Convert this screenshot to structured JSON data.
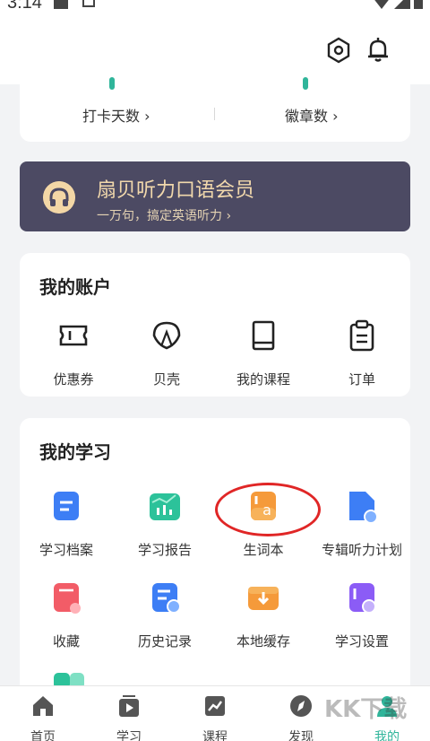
{
  "status_bar": {
    "time": "3:14"
  },
  "top_bar": {
    "icons": [
      "settings-hexagon-icon",
      "bell-icon"
    ]
  },
  "stats": {
    "checkin_label": "打卡天数",
    "badges_label": "徽章数",
    "chevron": "›"
  },
  "vip": {
    "title": "扇贝听力口语会员",
    "subtitle": "一万句，搞定英语听力 ›"
  },
  "account": {
    "title": "我的账户",
    "items": [
      {
        "label": "优惠券",
        "icon": "coupon-icon"
      },
      {
        "label": "贝壳",
        "icon": "shell-icon"
      },
      {
        "label": "我的课程",
        "icon": "book-icon"
      },
      {
        "label": "订单",
        "icon": "clipboard-icon"
      }
    ]
  },
  "study": {
    "title": "我的学习",
    "items": [
      {
        "label": "学习档案",
        "icon": "file-icon",
        "color": "#3d7ef5"
      },
      {
        "label": "学习报告",
        "icon": "chart-icon",
        "color": "#2cc29a"
      },
      {
        "label": "生词本",
        "icon": "vocab-book-icon",
        "color": "#f59a3a"
      },
      {
        "label": "专辑听力计划",
        "icon": "plan-icon",
        "color": "#3d7ef5"
      },
      {
        "label": "收藏",
        "icon": "favorite-icon",
        "color": "#f25c67"
      },
      {
        "label": "历史记录",
        "icon": "history-icon",
        "color": "#3d7ef5"
      },
      {
        "label": "本地缓存",
        "icon": "download-icon",
        "color": "#f59a3a"
      },
      {
        "label": "学习设置",
        "icon": "settings-icon",
        "color": "#8b5cf6"
      }
    ]
  },
  "tabs": [
    {
      "label": "首页",
      "icon": "home-icon"
    },
    {
      "label": "学习",
      "icon": "play-icon"
    },
    {
      "label": "课程",
      "icon": "trend-icon"
    },
    {
      "label": "发现",
      "icon": "compass-icon"
    },
    {
      "label": "我的",
      "icon": "user-icon"
    }
  ],
  "watermark": "KK下载"
}
